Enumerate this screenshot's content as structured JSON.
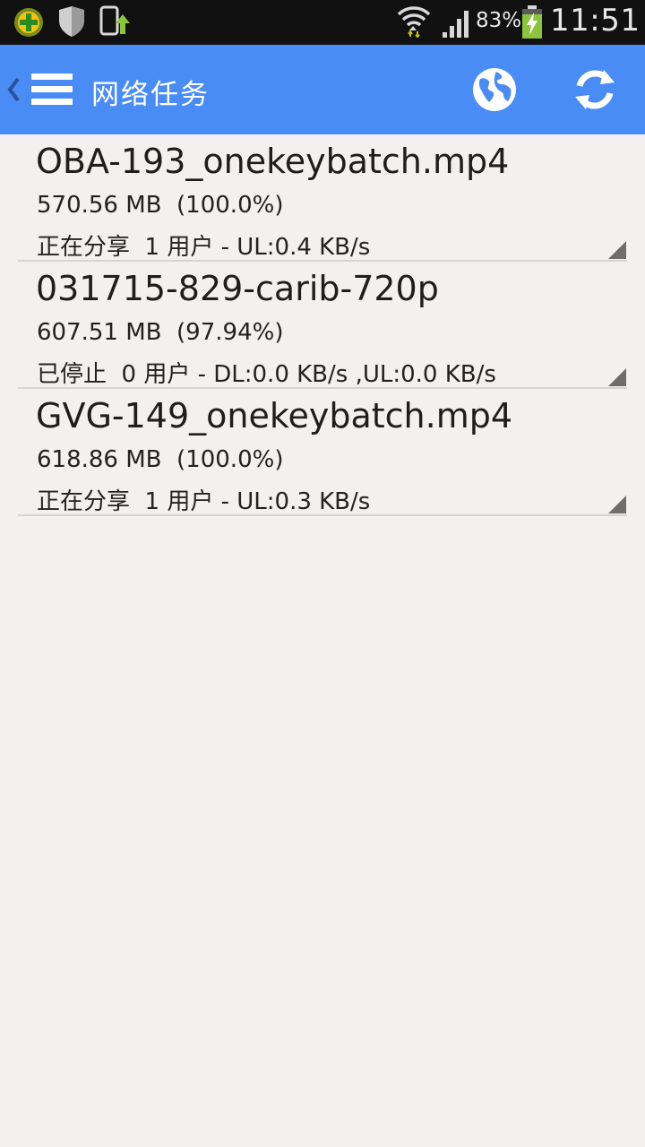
{
  "status_bar": {
    "icons": [
      "app-plus-icon",
      "shield-icon",
      "phone-upload-icon",
      "wifi-icon",
      "signal-icon",
      "battery-charging-icon"
    ],
    "battery_percent": "83%",
    "time": "11:51"
  },
  "action_bar": {
    "back_icon": "chevron-left-icon",
    "menu_icon": "hamburger-menu-icon",
    "title": "网络任务",
    "globe_icon": "globe-icon",
    "refresh_icon": "refresh-icon",
    "background_color": "#4a8cf6"
  },
  "tasks": [
    {
      "name": "OBA-193_onekeybatch.mp4",
      "size": "570.56 MB  (100.0%)",
      "status": "正在分享  1 用户 - UL:0.4 KB/s"
    },
    {
      "name": "031715-829-carib-720p",
      "size": "607.51 MB  (97.94%)",
      "status": "已停止  0 用户 - DL:0.0 KB/s ,UL:0.0 KB/s"
    },
    {
      "name": "GVG-149_onekeybatch.mp4",
      "size": "618.86 MB  (100.0%)",
      "status": "正在分享  1 用户 - UL:0.3 KB/s"
    }
  ]
}
